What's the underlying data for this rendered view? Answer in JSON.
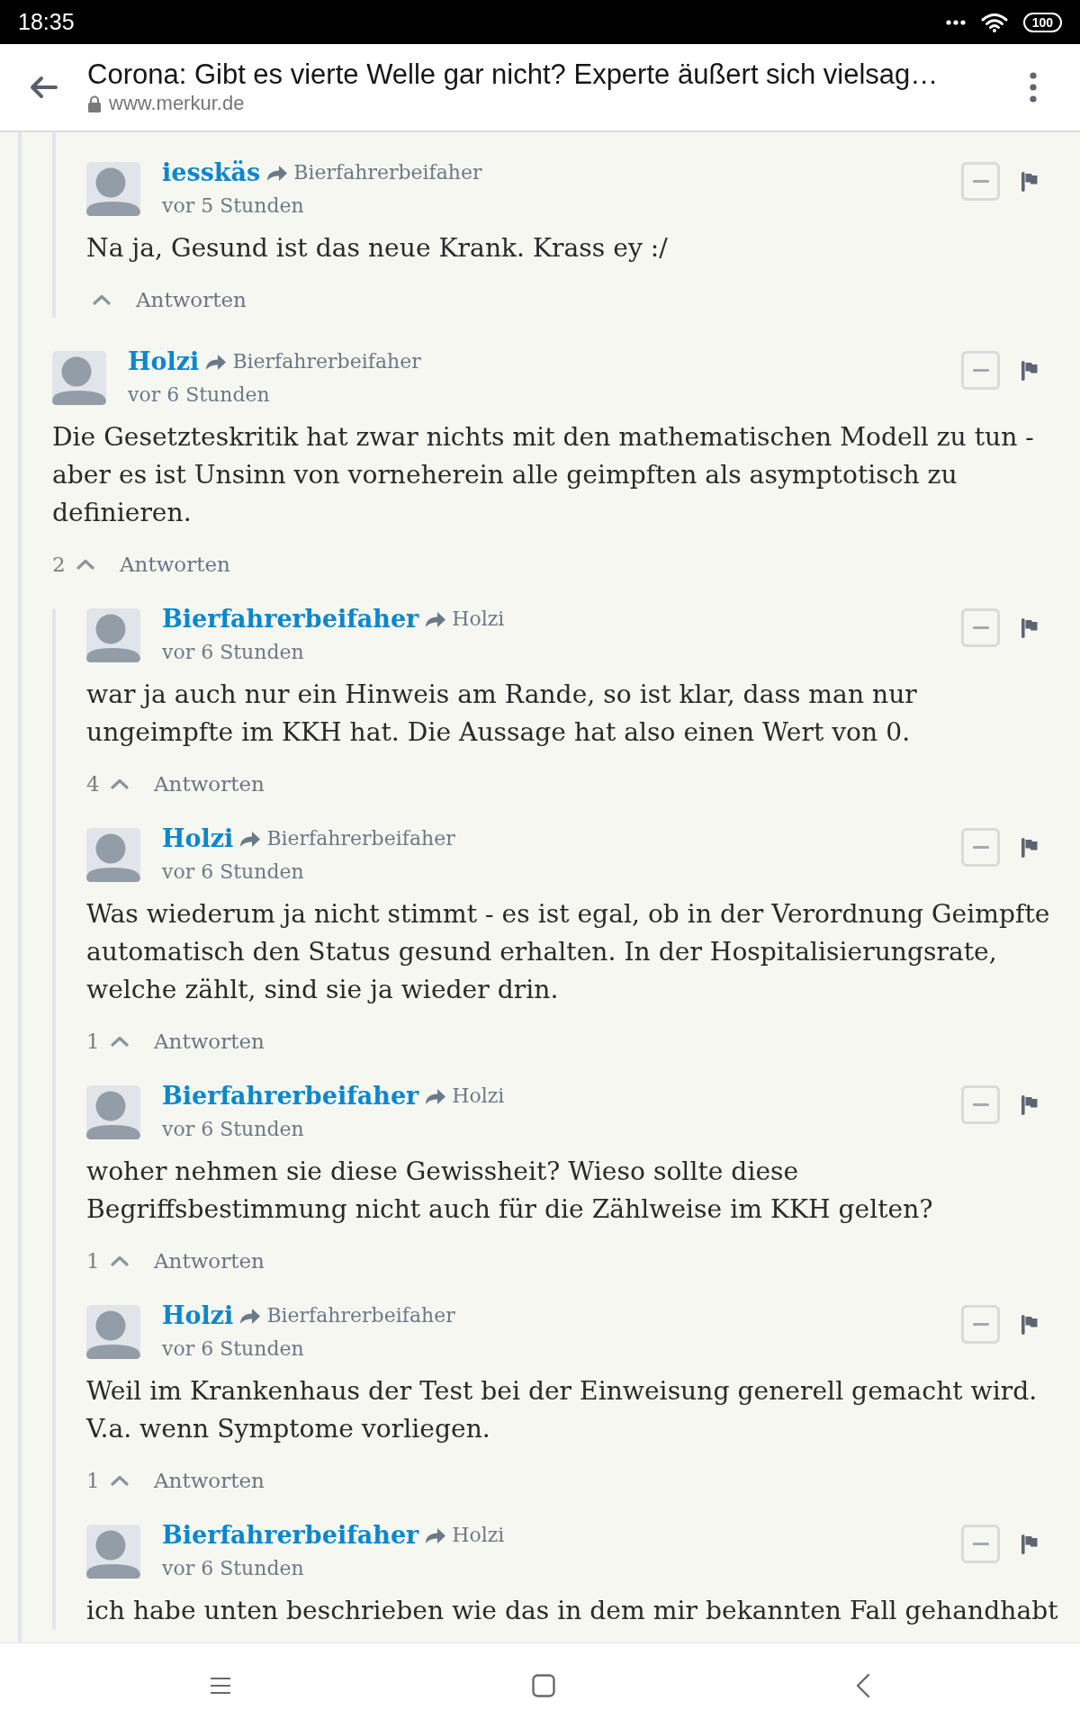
{
  "status_bar": {
    "time": "18:35",
    "battery": "100"
  },
  "header": {
    "title": "Corona: Gibt es vierte Welle gar nicht? Experte äußert sich vielsag…",
    "url": "www.merkur.de"
  },
  "comments": [
    {
      "kind": "continuation",
      "children": [
        {
          "kind": "comment",
          "author": "iesskäs",
          "reply_to": "Bierfahrerbeifaher",
          "time": "vor 5 Stunden",
          "body": "Na ja, Gesund ist das neue Krank. Krass ey :/",
          "reply_label": "Antworten"
        }
      ]
    },
    {
      "kind": "comment",
      "author": "Holzi",
      "reply_to": "Bierfahrerbeifaher",
      "time": "vor 6 Stunden",
      "body": "Die Gesetzteskritik hat zwar nichts mit den mathematischen Modell zu tun - aber es ist Unsinn von vorneherein alle geimpften als asymptotisch zu definieren.",
      "votes": "2",
      "reply_label": "Antworten",
      "children": [
        {
          "kind": "comment",
          "author": "Bierfahrerbeifaher",
          "reply_to": "Holzi",
          "time": "vor 6 Stunden",
          "body": "war ja auch nur ein Hinweis am Rande, so ist klar, dass man nur ungeimpfte im KKH hat. Die Aussage hat also einen Wert von 0.",
          "votes": "4",
          "reply_label": "Antworten"
        },
        {
          "kind": "comment",
          "author": "Holzi",
          "reply_to": "Bierfahrerbeifaher",
          "time": "vor 6 Stunden",
          "body": "Was wiederum ja nicht stimmt - es ist egal, ob in der Verordnung Geimpfte automatisch den Status gesund erhalten. In der Hospitalisierungsrate, welche zählt, sind sie ja wieder drin.",
          "votes": "1",
          "reply_label": "Antworten"
        },
        {
          "kind": "comment",
          "author": "Bierfahrerbeifaher",
          "reply_to": "Holzi",
          "time": "vor 6 Stunden",
          "body": "woher nehmen sie diese Gewissheit? Wieso sollte diese Begriffsbestimmung nicht auch für die Zählweise im KKH gelten?",
          "votes": "1",
          "reply_label": "Antworten"
        },
        {
          "kind": "comment",
          "author": "Holzi",
          "reply_to": "Bierfahrerbeifaher",
          "time": "vor 6 Stunden",
          "body": "Weil im Krankenhaus der Test bei der Einweisung generell gemacht wird. V.a. wenn Symptome vorliegen.",
          "votes": "1",
          "reply_label": "Antworten"
        },
        {
          "kind": "comment",
          "author": "Bierfahrerbeifaher",
          "reply_to": "Holzi",
          "time": "vor 6 Stunden",
          "body": "ich habe unten beschrieben wie das in dem mir bekannten Fall gehandhabt"
        }
      ]
    }
  ]
}
